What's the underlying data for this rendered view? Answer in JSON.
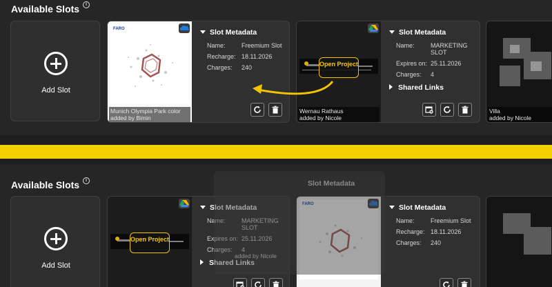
{
  "title": "Available Slots",
  "info_glyph": "i",
  "add_slot_label": "Add Slot",
  "metadata_title": "Slot Metadata",
  "shared_links_label": "Shared Links",
  "open_project_label": "Open Project",
  "accent_color": "#f5d000",
  "slots": {
    "munich": {
      "caption": "Munich Olympia Park color",
      "added_by": "added by Bimin",
      "name_label": "Name:",
      "name_value": "Freemium Slot",
      "recharge_label": "Recharge:",
      "recharge_value": "18.11.2026",
      "charges_label": "Charges:",
      "charges_value": "240",
      "logo": "FARO",
      "storage_icon": "onedrive-icon"
    },
    "wernau": {
      "caption": "Wernau Rathaus",
      "added_by": "added by Nicole",
      "name_label": "Name:",
      "name_value": "MARKETING SLOT",
      "expires_label": "Expires on:",
      "expires_value": "25.11.2026",
      "charges_label": "Charges:",
      "charges_value": "4",
      "storage_icon": "google-drive-icon"
    },
    "villa": {
      "caption": "Villa",
      "added_by": "added by Nicole"
    }
  },
  "ghost": {
    "name_fragment_1": "MA",
    "name_fragment_2": "RKETING",
    "name_fragment_3": "SLOT",
    "added_by_fragment": "added by Nicole"
  }
}
